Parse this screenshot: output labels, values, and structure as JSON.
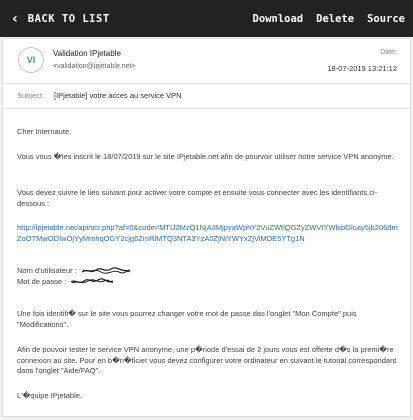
{
  "toolbar": {
    "back_label": "BACK TO LIST",
    "download_label": "Download",
    "delete_label": "Delete",
    "source_label": "Source"
  },
  "email": {
    "avatar_initials": "VI",
    "sender_name": "Validation IPjetable",
    "sender_email": "<validation@ipjetable.net>",
    "date_label": "Date:",
    "date_value": "18-07-2019 13:21:12",
    "subject_label": "Subject:",
    "subject": "[IPjetable] votre acces au service VPN"
  },
  "body": {
    "greeting": "Cher Internaute,",
    "p1": "Vous vous �tes inscrit le 18/07/2019 sur le site IPjetable.net afin de pourvoir utiliser notre service VPN anonyme.",
    "p2": "Vous devez suivre le lien suivant pour activer votre compte et ensuite vous connecter avec les identifiants ci-dessous :",
    "link": "http://ipjetable.net/api/scr.php?af=0&code=MTU2MzQ1NjA3MjpyaWphY2VuZWtlQGZyZWVtYWlsbGluay5jb206dmZoOTMwODIwOjYyMmhqOGY2cjg6ZmRlMTQ3NTA3YzA0ZjNiYWYxZjViMDE5YTg1N",
    "username_label": "Nom d'utilisateur :",
    "password_label": "Mot de passe :",
    "p3": "Une fois identifi� sur le site vous pourrez changer votre mot de passe das l'onglet \"Mon Compte\" puis \"Modifications\".",
    "p4": "Afin de pouvoir tester le service VPN anonyme, une p�riode d'essai de 2 jours vous est offerte d�s la premi�re connexion au site. Pour en b�n�ficier vous devez configurer votre ordinateur en suivant le tutorial correspondant dans l'onglet \"Aide/FAQ\".",
    "signoff": "L'�quipe IPjetable."
  },
  "colors": {
    "topbar": "#222222",
    "link": "#2a6ebb",
    "avatar_text": "#3f9a8f"
  },
  "icons": {
    "back": "chevron-left-icon",
    "redaction": "scribble-redaction"
  }
}
